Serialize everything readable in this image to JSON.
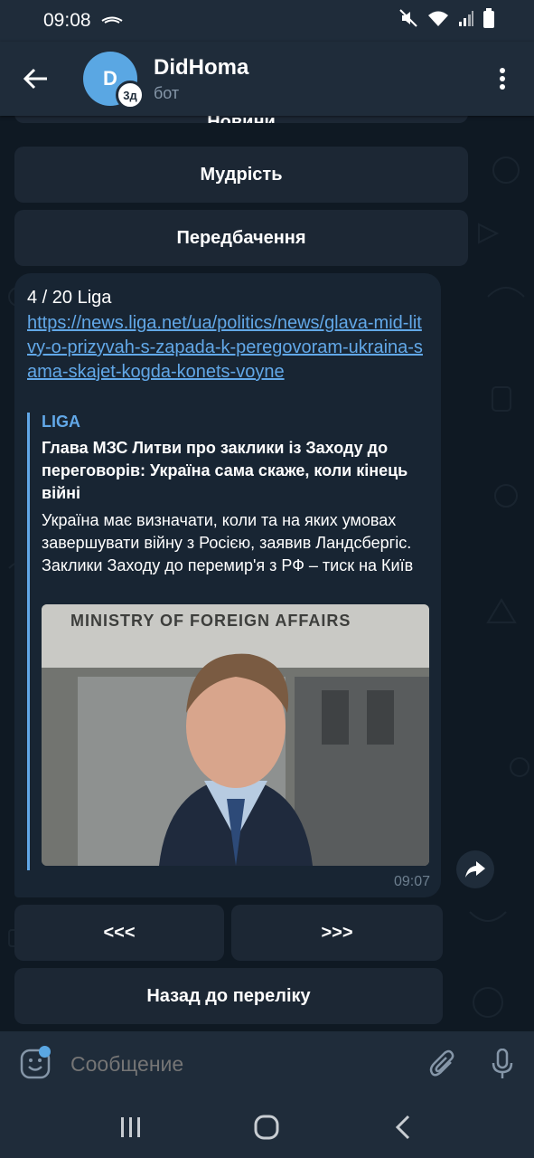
{
  "status_bar": {
    "time": "09:08"
  },
  "header": {
    "title": "DidHoma",
    "subtitle": "бот",
    "avatar_letter": "D",
    "avatar_badge": "3д"
  },
  "keyboard_top": {
    "buttons": [
      "Новини",
      "Мудрість",
      "Передбачення"
    ]
  },
  "message": {
    "head": "4 / 20 Liga",
    "link": "https://news.liga.net/ua/politics/news/glava-mid-litvy-o-prizyvah-s-zapada-k-peregovoram-ukraina-sama-skajet-kogda-konets-voyne",
    "preview": {
      "site": "LIGA",
      "title": "Глава МЗС Литви про заклики із Заходу до переговорів: Україна сама скаже, коли кінець війні",
      "description": "Україна має визначати, коли та на яких умовах завершувати війну з Росією, заявив Ландсбергіс. Заклики Заходу до перемир'я з РФ – тиск на Київ",
      "image_sign": "MINISTRY OF FOREIGN AFFAIRS"
    },
    "time": "09:07"
  },
  "keyboard_bottom": {
    "prev": "<<<",
    "next": ">>>",
    "back": "Назад до переліку"
  },
  "input": {
    "placeholder": "Сообщение"
  },
  "colors": {
    "accent": "#62a8e8",
    "background": "#0e1621",
    "bubble": "#182533",
    "bar": "#1f2c3a"
  }
}
